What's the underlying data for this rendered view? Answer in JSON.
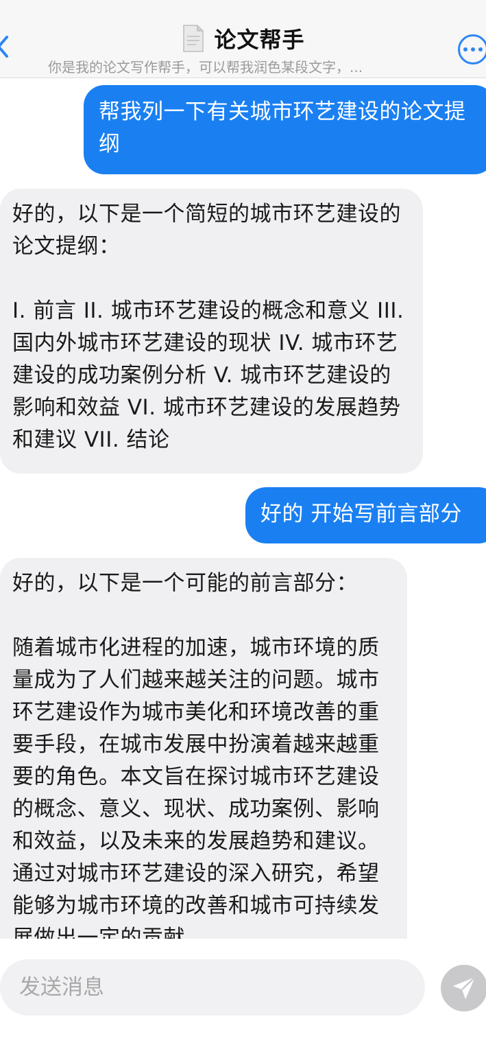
{
  "header": {
    "title": "论文帮手",
    "subtitle": "你是我的论文写作帮手，可以帮我润色某段文字，...",
    "back_icon": "chevron-left-icon",
    "doc_icon": "document-icon",
    "more_icon": "more-horizontal-icon"
  },
  "messages": [
    {
      "role": "user",
      "text": "帮我列一下有关城市环艺建设的论文提纲"
    },
    {
      "role": "assistant",
      "text": "好的，以下是一个简短的城市环艺建设的论文提纲：\n\nI. 前言 II. 城市环艺建设的概念和意义 III. 国内外城市环艺建设的现状 IV. 城市环艺建设的成功案例分析 V. 城市环艺建设的影响和效益 VI. 城市环艺建设的发展趋势和建议 VII. 结论"
    },
    {
      "role": "user",
      "text": "好的 开始写前言部分"
    },
    {
      "role": "assistant",
      "text": "好的，以下是一个可能的前言部分：\n\n随着城市化进程的加速，城市环境的质量成为了人们越来越关注的问题。城市环艺建设作为城市美化和环境改善的重要手段，在城市发展中扮演着越来越重要的角色。本文旨在探讨城市环艺建设的概念、意义、现状、成功案例、影响和效益，以及未来的发展趋势和建议。通过对城市环艺建设的深入研究，希望能够为城市环境的改善和城市可持续发展做出一定的贡献。"
    }
  ],
  "composer": {
    "placeholder": "发送消息",
    "send_icon": "send-icon"
  },
  "colors": {
    "accent": "#1a80f2",
    "bot_bubble": "#f0f0f2",
    "send_disabled": "#c9c9cc"
  }
}
